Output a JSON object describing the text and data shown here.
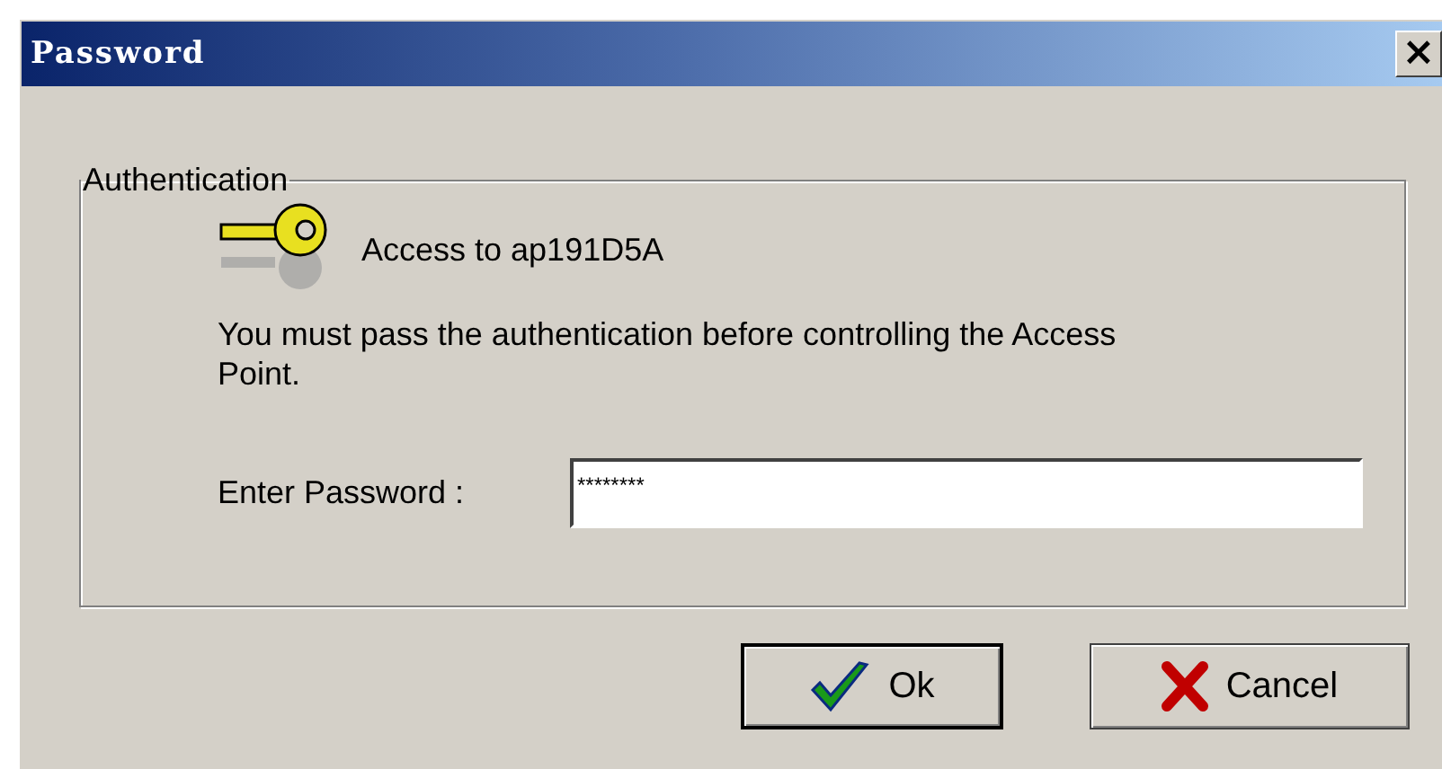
{
  "window": {
    "title": "Password",
    "close": "×"
  },
  "group": {
    "title": "Authentication",
    "heading": "Access to ap191D5A",
    "message": "You must pass the authentication before controlling the Access Point.",
    "password": {
      "label": "Enter Password :",
      "value": "********"
    }
  },
  "buttons": [
    {
      "label": "Ok",
      "kind": "ok",
      "default": true
    },
    {
      "label": "Cancel",
      "kind": "cancel",
      "default": false
    }
  ]
}
